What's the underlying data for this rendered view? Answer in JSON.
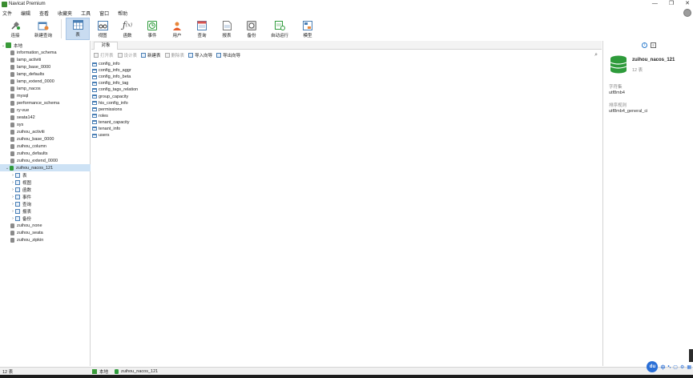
{
  "window": {
    "title": "Navicat Premium",
    "minimize": "—",
    "maximize": "❐",
    "close": "✕"
  },
  "menu": [
    "文件",
    "编辑",
    "查看",
    "收藏夹",
    "工具",
    "窗口",
    "帮助"
  ],
  "toolbar": {
    "connect": "连接",
    "new_query": "新建查询",
    "table": "表",
    "view": "视图",
    "function": "函数",
    "event": "事件",
    "user": "用户",
    "query": "查询",
    "report": "报表",
    "backup": "备份",
    "automation": "自动运行",
    "model": "模型",
    "active": "表"
  },
  "sidebar": {
    "connection": "本地",
    "databases": [
      "information_schema",
      "lamp_activiti",
      "lamp_base_0000",
      "lamp_defaults",
      "lamp_extend_0000",
      "lamp_nacos",
      "mysql",
      "performance_schema",
      "ry-vue",
      "seata142",
      "sys",
      "zuihou_activiti",
      "zuihou_base_0000",
      "zuihou_column",
      "zuihou_defaults",
      "zuihou_extend_0000"
    ],
    "open_db": "zuihou_nacos_121",
    "open_db_children": [
      "表",
      "视图",
      "函数",
      "事件",
      "查询",
      "报表",
      "备份"
    ],
    "databases_after": [
      "zuihou_none",
      "zuihou_seata",
      "zuihou_zipkin"
    ]
  },
  "main": {
    "tab": "对象",
    "actions": {
      "open_table": "打开表",
      "design_table": "设计表",
      "new_table": "新建表",
      "delete_table": "删除表",
      "import_wizard": "导入向导",
      "export_wizard": "导出向导"
    },
    "tables": [
      "config_info",
      "config_info_aggr",
      "config_info_beta",
      "config_info_tag",
      "config_tags_relation",
      "group_capacity",
      "his_config_info",
      "permissions",
      "roles",
      "tenant_capacity",
      "tenant_info",
      "users"
    ]
  },
  "info_panel": {
    "db_name": "zuihou_nacos_121",
    "table_count": "12 表",
    "charset_label": "字符集",
    "charset_value": "utf8mb4",
    "collation_label": "排序规则",
    "collation_value": "utf8mb4_general_ci"
  },
  "status": {
    "count": "12 表",
    "connection": "本地",
    "database": "zuihou_nacos_121"
  },
  "tray": {
    "du": "du",
    "lang": "中",
    "punct": "•,"
  }
}
